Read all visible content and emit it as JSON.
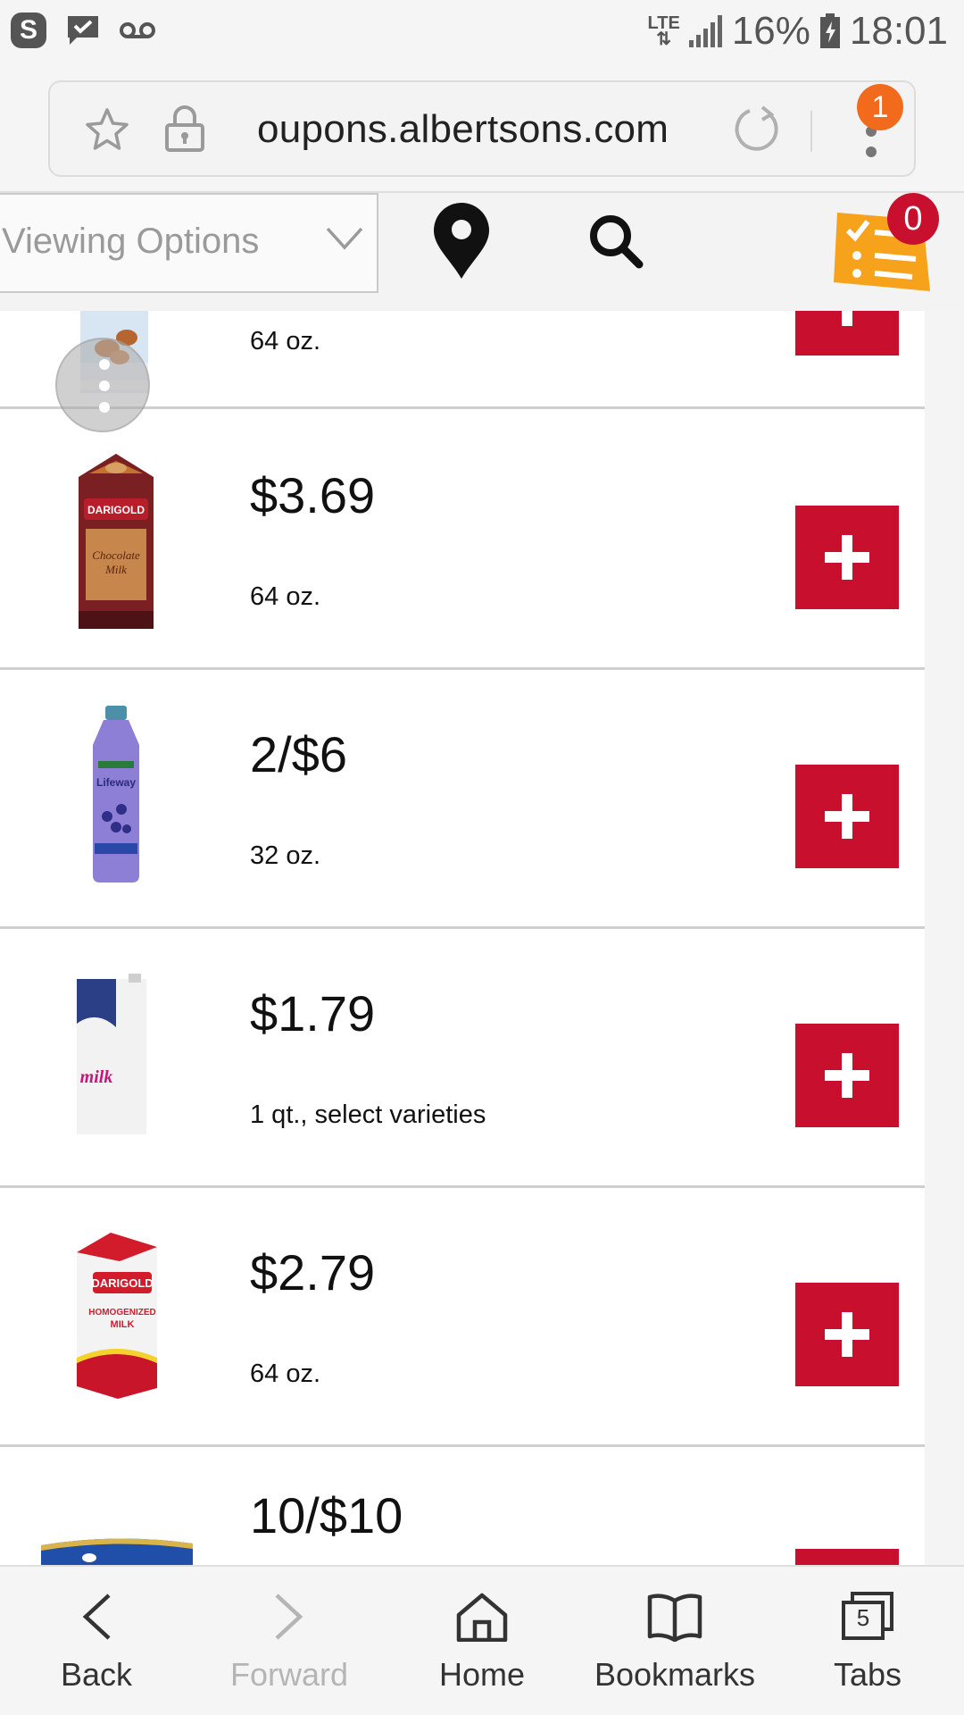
{
  "status_bar": {
    "network": "LTE",
    "battery": "16%",
    "time": "18:01"
  },
  "browser": {
    "url": "oupons.albertsons.com",
    "notification_count": "1"
  },
  "header": {
    "viewing_options_label": "Viewing Options",
    "list_count": "0"
  },
  "coupons": [
    {
      "price": "",
      "size": "64 oz.",
      "product": "almond milk"
    },
    {
      "price": "$3.69",
      "size": "64 oz.",
      "product": "Darigold chocolate milk"
    },
    {
      "price": "2/$6",
      "size": "32 oz.",
      "product": "Lifeway blueberry kefir"
    },
    {
      "price": "$1.79",
      "size": "1 qt., select varieties",
      "product": "Parmalat whole milk"
    },
    {
      "price": "$2.79",
      "size": "64 oz.",
      "product": "Darigold homogenized milk"
    },
    {
      "price": "10/$10",
      "size": "",
      "product": "dough can"
    }
  ],
  "bottom_nav": {
    "back": "Back",
    "forward": "Forward",
    "home": "Home",
    "bookmarks": "Bookmarks",
    "tabs": "Tabs",
    "tabs_count": "5"
  },
  "colors": {
    "accent_red": "#c8102e",
    "list_orange": "#f7a21b",
    "notification_orange": "#f26a1b"
  }
}
